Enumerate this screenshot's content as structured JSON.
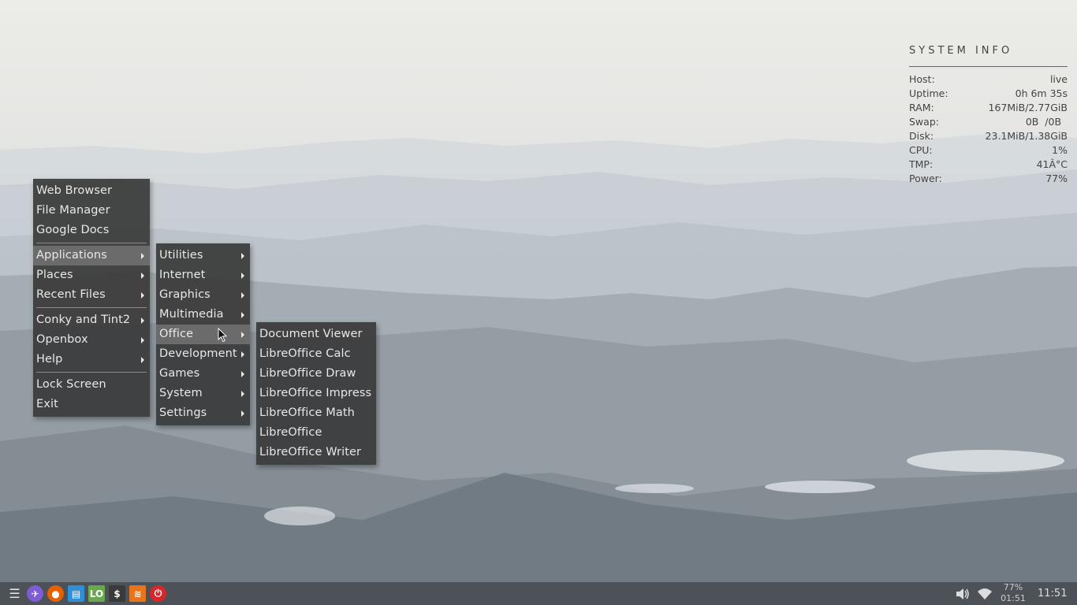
{
  "main_menu": {
    "items": [
      {
        "label": "Web Browser"
      },
      {
        "label": "File Manager"
      },
      {
        "label": "Google Docs"
      },
      {
        "separator": true
      },
      {
        "label": "Applications",
        "submenu": true,
        "active": true
      },
      {
        "label": "Places",
        "submenu": true
      },
      {
        "label": "Recent Files",
        "submenu": true
      },
      {
        "separator": true
      },
      {
        "label": "Conky and Tint2",
        "submenu": true
      },
      {
        "label": "Openbox",
        "submenu": true
      },
      {
        "label": "Help",
        "submenu": true
      },
      {
        "separator": true
      },
      {
        "label": "Lock Screen"
      },
      {
        "label": "Exit"
      }
    ]
  },
  "applications_menu": {
    "items": [
      {
        "label": "Utilities",
        "submenu": true
      },
      {
        "label": "Internet",
        "submenu": true
      },
      {
        "label": "Graphics",
        "submenu": true
      },
      {
        "label": "Multimedia",
        "submenu": true
      },
      {
        "label": "Office",
        "submenu": true,
        "active": true
      },
      {
        "label": "Development",
        "submenu": true
      },
      {
        "label": "Games",
        "submenu": true
      },
      {
        "label": "System",
        "submenu": true
      },
      {
        "label": "Settings",
        "submenu": true
      }
    ]
  },
  "office_menu": {
    "items": [
      {
        "label": "Document Viewer"
      },
      {
        "label": "LibreOffice Calc"
      },
      {
        "label": "LibreOffice Draw"
      },
      {
        "label": "LibreOffice Impress"
      },
      {
        "label": "LibreOffice Math"
      },
      {
        "label": "LibreOffice"
      },
      {
        "label": "LibreOffice Writer"
      }
    ]
  },
  "conky": {
    "title": "SYSTEM INFO",
    "rows": [
      {
        "label": "Host:",
        "value": "live"
      },
      {
        "label": "Uptime:",
        "value": "0h 6m 35s"
      },
      {
        "label": "RAM:",
        "value": "167MiB/2.77GiB"
      },
      {
        "label": "Swap:",
        "value": "0B  /0B  "
      },
      {
        "label": "Disk:",
        "value": "23.1MiB/1.38GiB"
      },
      {
        "label": "CPU:",
        "value": "1%"
      },
      {
        "label": "TMP:",
        "value": "41Â°C"
      },
      {
        "label": "Power:",
        "value": "77%"
      }
    ]
  },
  "taskbar": {
    "launchers": [
      {
        "name": "menu-icon",
        "glyph": "☰",
        "color": "#e0e0e0"
      },
      {
        "name": "openbox-logo-icon",
        "glyph": "✈",
        "color": "#7d5cd6"
      },
      {
        "name": "firefox-icon",
        "glyph": "●",
        "color": "#e66000"
      },
      {
        "name": "file-manager-icon",
        "glyph": "▤",
        "color": "#2f8fd8"
      },
      {
        "name": "libreoffice-icon",
        "glyph": "LO",
        "color": "#6aa84f"
      },
      {
        "name": "terminal-icon",
        "glyph": "$",
        "color": "#3a3a3a"
      },
      {
        "name": "conky-tint2-icon",
        "glyph": "≋",
        "color": "#e8741c"
      },
      {
        "name": "power-icon",
        "glyph": "⏻",
        "color": "#d9262b"
      }
    ],
    "battery_percent": "77%",
    "battery_time": "01:51",
    "clock": "11:51"
  }
}
